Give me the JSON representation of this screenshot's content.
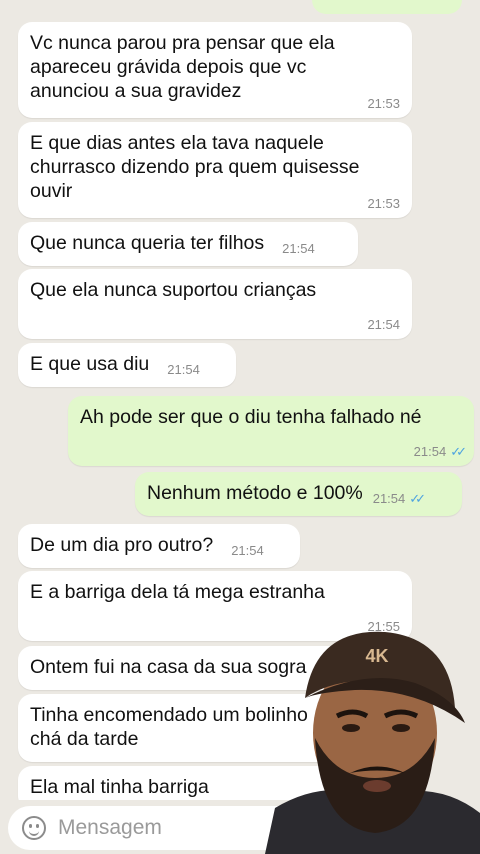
{
  "messages": [
    {
      "side": "in",
      "lines": [
        "Vc nunca parou pra pensar que ela",
        "apareceu grávida depois que vc",
        "anunciou a sua gravidez"
      ],
      "time": "21:53"
    },
    {
      "side": "in",
      "lines": [
        "E que dias antes ela tava naquele",
        "churrasco dizendo pra quem quisesse",
        "ouvir"
      ],
      "time": "21:53"
    },
    {
      "side": "in",
      "lines": [
        "Que nunca queria ter filhos"
      ],
      "time": "21:54"
    },
    {
      "side": "in",
      "lines": [
        "Que ela nunca suportou crianças"
      ],
      "time": "21:54"
    },
    {
      "side": "in",
      "lines": [
        "E que usa diu"
      ],
      "time": "21:54"
    },
    {
      "side": "out",
      "lines": [
        "Ah pode ser que o diu tenha falhado né"
      ],
      "time": "21:54"
    },
    {
      "side": "out",
      "lines": [
        "Nenhum método e 100%"
      ],
      "time": "21:54"
    },
    {
      "side": "in",
      "lines": [
        "De um dia pro outro?"
      ],
      "time": "21:54"
    },
    {
      "side": "in",
      "lines": [
        "E a barriga dela tá mega estranha"
      ],
      "time": "21:55"
    },
    {
      "side": "in",
      "lines": [
        "Ontem fui na casa da sua sogra"
      ],
      "time": ""
    },
    {
      "side": "in",
      "lines": [
        "Tinha encomendado um bolinho",
        "chá da tarde"
      ],
      "time": ""
    },
    {
      "side": "in",
      "lines": [
        "Ela mal tinha barriga"
      ],
      "time": ""
    }
  ],
  "input": {
    "placeholder": "Mensagem"
  },
  "overlay": {
    "cap_text": "4K"
  }
}
